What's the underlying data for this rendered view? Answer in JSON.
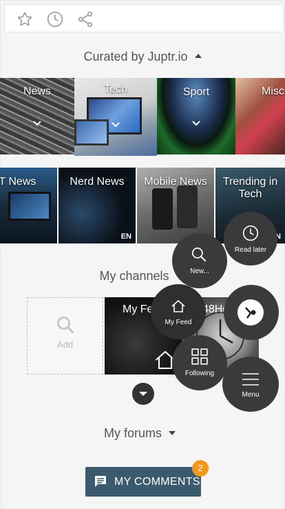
{
  "colors": {
    "accent": "#3c5a6e",
    "badge": "#f39a1d",
    "fab": "#3a3a3a"
  },
  "toolbar": {
    "icons": [
      "star-icon",
      "clock-icon",
      "share-icon"
    ]
  },
  "curated": {
    "title": "Curated by Juptr.io",
    "categories": [
      {
        "label": "News"
      },
      {
        "label": "Tech"
      },
      {
        "label": "Sport"
      },
      {
        "label": "Misc"
      }
    ]
  },
  "feeds": [
    {
      "label": "IT News"
    },
    {
      "label": "Nerd News",
      "lang": "EN"
    },
    {
      "label": "Mobile News"
    },
    {
      "label": "Trending in Tech",
      "lang": "EN"
    }
  ],
  "channels": {
    "title": "My channels",
    "add_label": "Add",
    "items": [
      {
        "label": "My Feed"
      },
      {
        "label": "48Hours"
      }
    ]
  },
  "radial_menu": {
    "new": "New...",
    "read_later": "Read later",
    "my_feed": "My Feed",
    "following": "Following",
    "menu": "Menu"
  },
  "forums": {
    "title": "My forums"
  },
  "comments": {
    "label": "MY COMMENTS",
    "count": "2"
  }
}
